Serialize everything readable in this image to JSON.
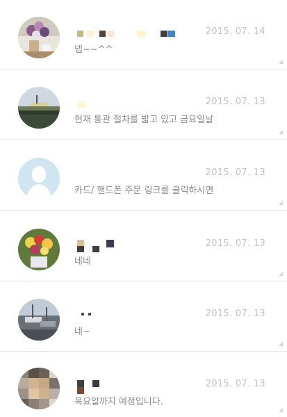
{
  "conversations": [
    {
      "date": "2015. 07. 14",
      "message": "넵~~^^",
      "avatar_icon": "flower-vase-photo-icon"
    },
    {
      "date": "2015. 07. 13",
      "message": "현재 통관 절차를 밟고 있고 금요일날",
      "avatar_icon": "boat-on-water-photo-icon"
    },
    {
      "date": "2015. 07. 13",
      "message": "카드/ 핸드폰 주문 링크를 클릭하시면",
      "avatar_icon": "default-person-icon"
    },
    {
      "date": "2015. 07. 13",
      "message": "네네",
      "avatar_icon": "flower-bouquet-photo-icon"
    },
    {
      "date": "2015. 07. 13",
      "message": "네~",
      "avatar_icon": "harbor-boats-photo-icon"
    },
    {
      "date": "2015. 07. 13",
      "message": "목요일까지 예정입니다.",
      "avatar_icon": "pixelated-photo-icon"
    }
  ]
}
